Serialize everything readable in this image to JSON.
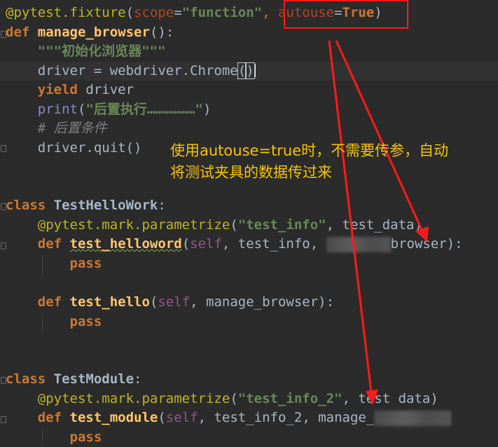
{
  "code": {
    "l1": {
      "at": "@",
      "decorator": "pytest.fixture",
      "open": "(",
      "kw_scope": "scope",
      "eq": "=",
      "str_function": "\"function\"",
      "comma": ", ",
      "kw_autouse": "autouse",
      "eq2": "=",
      "true": "True",
      "close": ")"
    },
    "l2": {
      "def": "def",
      "name": "manage_browser",
      "rest": "():"
    },
    "l3": {
      "docstring": "\"\"\"初始化浏览器\"\"\""
    },
    "l4": {
      "a": "driver = webdriver.",
      "b": "Chrome",
      "open": "(",
      "close": ")"
    },
    "l5": {
      "kw": "yield",
      "rest": " driver"
    },
    "l6": {
      "builtin": "print",
      "open": "(",
      "str": "\"后置执行………………\"",
      "close": ")"
    },
    "l7": {
      "comment": "# 后置条件"
    },
    "l8": {
      "a": "driver.",
      "b": "quit",
      "c": "()"
    },
    "l9": {
      "kw": "class",
      "name": "TestHelloWork",
      "colon": ":"
    },
    "l10": {
      "at": "@",
      "dec": "pytest.mark.parametrize",
      "open": "(",
      "str": "\"test_info\"",
      "rest": ", test_data)"
    },
    "l11": {
      "def": "def",
      "name": "test_helloword",
      "open": "(",
      "self": "self",
      "a": ", test_info, ",
      "b": "browser):"
    },
    "l12": {
      "kw": "pass"
    },
    "l13": {
      "def": "def",
      "name": "test_hello",
      "open": "(",
      "self": "self",
      "rest": ", manage_browser):"
    },
    "l14": {
      "kw": "pass"
    },
    "l15": {
      "kw": "class",
      "name": "TestModule",
      "colon": ":"
    },
    "l16": {
      "at": "@",
      "dec": "pytest.mark.parametrize",
      "open": "(",
      "str": "\"test_info_2\"",
      "rest": ", test data)"
    },
    "l17": {
      "def": "def",
      "name": "test_module",
      "open": "(",
      "self": "self",
      "rest": ", test_info_2, manage_"
    },
    "l18": {
      "kw": "pass"
    }
  },
  "annotation": {
    "line1": "使用autouse=true时，不需要传参，自动",
    "line2": "将测试夹具的数据传过来"
  },
  "colors": {
    "annotation": "#f5c400",
    "highlight_box": "#ff1a1a",
    "background": "#2b2b2b"
  }
}
